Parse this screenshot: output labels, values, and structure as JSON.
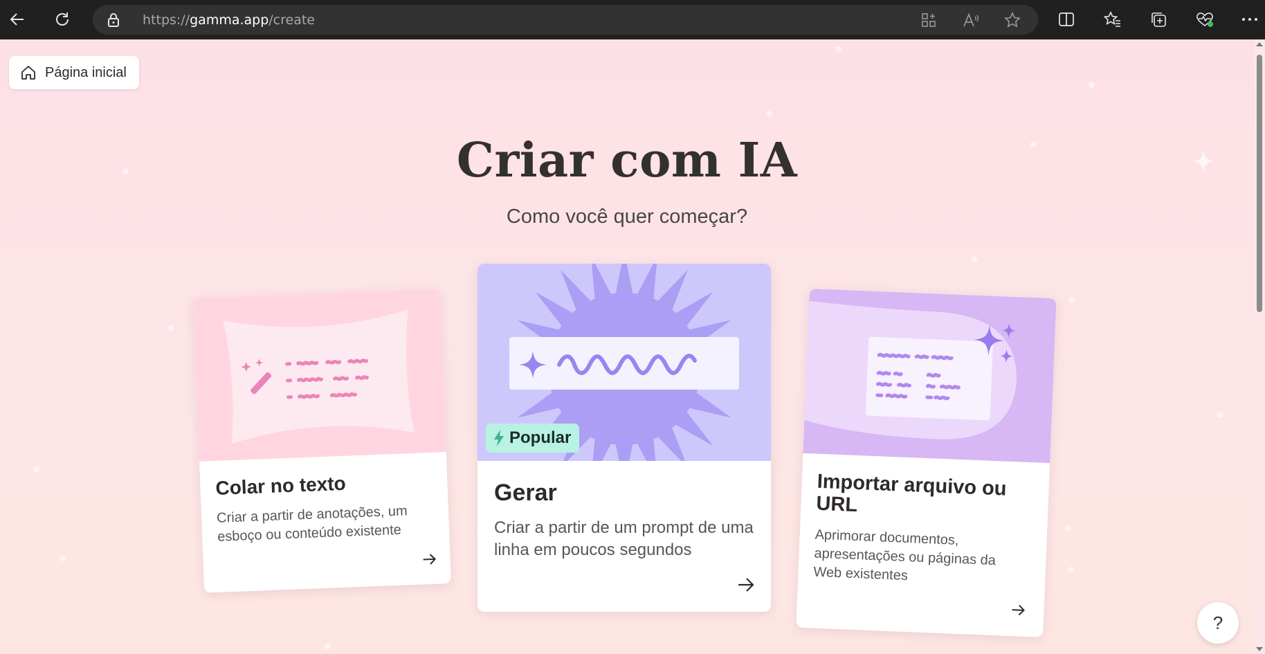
{
  "browser": {
    "url_prefix": "https://",
    "url_host": "gamma.app",
    "url_path": "/create",
    "icons": [
      "back-icon",
      "refresh-icon",
      "lock-icon",
      "apps-icon",
      "read-aloud-icon",
      "favorite-star-icon",
      "split-screen-icon",
      "favorites-icon",
      "collections-icon",
      "browser-essentials-icon",
      "more-icon"
    ]
  },
  "home_button": {
    "label": "Página inicial"
  },
  "header": {
    "title": "Criar com IA",
    "subtitle": "Como você quer começar?"
  },
  "cards": [
    {
      "title": "Colar no texto",
      "description": "Criar a partir de anotações, um esboço ou conteúdo existente"
    },
    {
      "title": "Gerar",
      "description": "Criar a partir de um prompt de uma linha em poucos segundos",
      "badge": "Popular"
    },
    {
      "title": "Importar arquivo ou URL",
      "description": "Aprimorar documentos, apresentações ou páginas da Web existentes"
    }
  ],
  "help": {
    "label": "?"
  },
  "colors": {
    "page_bg": "#fde5e7",
    "card1_art": "#ffd6df",
    "card2_art": "#c9c4fb",
    "card3_art": "#d7b7f4",
    "badge_bg": "#b7f2e3"
  }
}
